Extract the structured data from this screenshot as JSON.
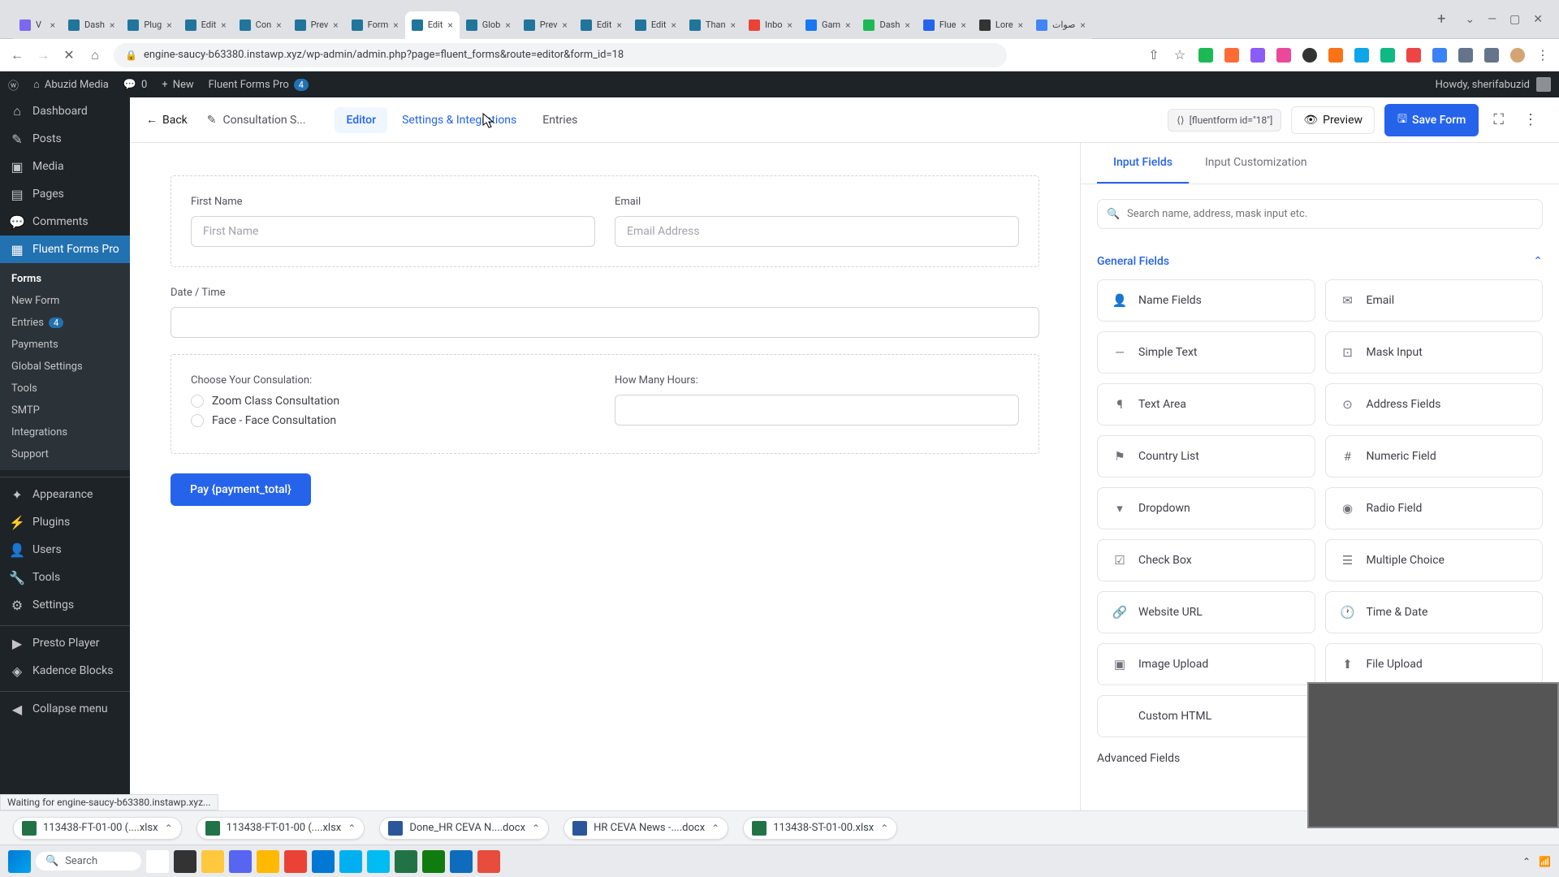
{
  "browser": {
    "tabs": [
      {
        "icon": "#7b68ee",
        "title": "V"
      },
      {
        "icon": "#21759b",
        "title": "Dash"
      },
      {
        "icon": "#21759b",
        "title": "Plug"
      },
      {
        "icon": "#21759b",
        "title": "Edit"
      },
      {
        "icon": "#21759b",
        "title": "Con"
      },
      {
        "icon": "#21759b",
        "title": "Prev"
      },
      {
        "icon": "#21759b",
        "title": "Form"
      },
      {
        "icon": "#21759b",
        "title": "Edit",
        "active": true
      },
      {
        "icon": "#21759b",
        "title": "Glob"
      },
      {
        "icon": "#21759b",
        "title": "Prev"
      },
      {
        "icon": "#21759b",
        "title": "Edit"
      },
      {
        "icon": "#21759b",
        "title": "Edit"
      },
      {
        "icon": "#21759b",
        "title": "Than"
      },
      {
        "icon": "#ea4335",
        "title": "Inbo"
      },
      {
        "icon": "#1877f2",
        "title": "Gam"
      },
      {
        "icon": "#1db954",
        "title": "Dash"
      },
      {
        "icon": "#2563eb",
        "title": "Flue"
      },
      {
        "icon": "#333",
        "title": "Lore"
      },
      {
        "icon": "#4285f4",
        "title": "صوات"
      }
    ],
    "url": "engine-saucy-b63380.instawp.xyz/wp-admin/admin.php?page=fluent_forms&route=editor&form_id=18"
  },
  "wpbar": {
    "site_name": "Abuzid Media",
    "comments": "0",
    "new_label": "New",
    "ff_label": "Fluent Forms Pro",
    "ff_count": "4",
    "howdy": "Howdy, sherifabuzid"
  },
  "sidebar": {
    "items": [
      {
        "icon": "⌂",
        "label": "Dashboard"
      },
      {
        "icon": "✎",
        "label": "Posts"
      },
      {
        "icon": "▣",
        "label": "Media"
      },
      {
        "icon": "▤",
        "label": "Pages"
      },
      {
        "icon": "💬",
        "label": "Comments"
      },
      {
        "icon": "▦",
        "label": "Fluent Forms Pro",
        "current": true
      }
    ],
    "submenu": [
      {
        "label": "Forms",
        "active": true
      },
      {
        "label": "New Form"
      },
      {
        "label": "Entries",
        "badge": "4"
      },
      {
        "label": "Payments"
      },
      {
        "label": "Global Settings"
      },
      {
        "label": "Tools"
      },
      {
        "label": "SMTP"
      },
      {
        "label": "Integrations"
      },
      {
        "label": "Support"
      }
    ],
    "items2": [
      {
        "icon": "✦",
        "label": "Appearance"
      },
      {
        "icon": "⚡",
        "label": "Plugins"
      },
      {
        "icon": "👤",
        "label": "Users"
      },
      {
        "icon": "🔧",
        "label": "Tools"
      },
      {
        "icon": "⚙",
        "label": "Settings"
      }
    ],
    "items3": [
      {
        "icon": "▶",
        "label": "Presto Player"
      },
      {
        "icon": "◈",
        "label": "Kadence Blocks"
      }
    ],
    "collapse": "Collapse menu"
  },
  "editor": {
    "back": "Back",
    "form_name": "Consultation S...",
    "tabs": {
      "editor": "Editor",
      "settings": "Settings & Integrations",
      "entries": "Entries"
    },
    "shortcode": "[fluentform id=\"18\"]",
    "preview": "Preview",
    "save": "Save Form"
  },
  "form": {
    "first_name_label": "First Name",
    "first_name_ph": "First Name",
    "email_label": "Email",
    "email_ph": "Email Address",
    "datetime_label": "Date / Time",
    "consultation_label": "Choose Your Consulation:",
    "opt1": "Zoom Class Consultation",
    "opt2": "Face - Face Consultation",
    "hours_label": "How Many Hours:",
    "submit": "Pay {payment_total}"
  },
  "panel": {
    "tab1": "Input Fields",
    "tab2": "Input Customization",
    "search_ph": "Search name, address, mask input etc.",
    "general_title": "General Fields",
    "fields": [
      {
        "icon": "👤",
        "label": "Name Fields"
      },
      {
        "icon": "✉",
        "label": "Email"
      },
      {
        "icon": "―",
        "label": "Simple Text"
      },
      {
        "icon": "⊡",
        "label": "Mask Input"
      },
      {
        "icon": "¶",
        "label": "Text Area"
      },
      {
        "icon": "⊙",
        "label": "Address Fields"
      },
      {
        "icon": "⚑",
        "label": "Country List"
      },
      {
        "icon": "#",
        "label": "Numeric Field"
      },
      {
        "icon": "▾",
        "label": "Dropdown"
      },
      {
        "icon": "◉",
        "label": "Radio Field"
      },
      {
        "icon": "☑",
        "label": "Check Box"
      },
      {
        "icon": "☰",
        "label": "Multiple Choice"
      },
      {
        "icon": "🔗",
        "label": "Website URL"
      },
      {
        "icon": "🕐",
        "label": "Time & Date"
      },
      {
        "icon": "▣",
        "label": "Image Upload"
      },
      {
        "icon": "⬆",
        "label": "File Upload"
      },
      {
        "icon": "</>",
        "label": "Custom HTML"
      }
    ],
    "advanced_title": "Advanced Fields"
  },
  "status": "Waiting for engine-saucy-b63380.instawp.xyz...",
  "downloads": [
    {
      "type": "excel",
      "name": "113438-FT-01-00 (....xlsx"
    },
    {
      "type": "excel",
      "name": "113438-FT-01-00 (....xlsx"
    },
    {
      "type": "word",
      "name": "Done_HR CEVA N....docx"
    },
    {
      "type": "word",
      "name": "HR CEVA News -....docx"
    },
    {
      "type": "excel",
      "name": "113438-ST-01-00.xlsx"
    }
  ],
  "taskbar": {
    "search": "Search"
  }
}
